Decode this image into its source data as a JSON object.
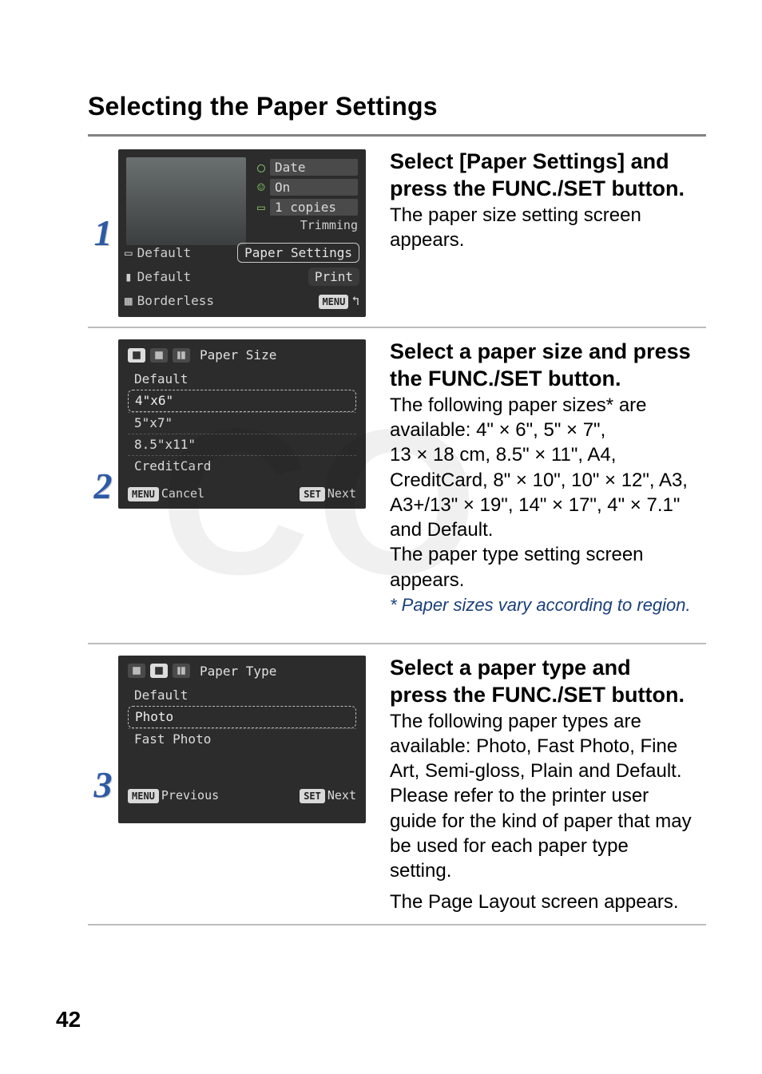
{
  "title": "Selecting the Paper Settings",
  "page_number": "42",
  "step1": {
    "number": "1",
    "heading_a": "Select [Paper Settings] and",
    "heading_b": "press the FUNC./SET button.",
    "body_a": "The paper size setting screen",
    "body_b": "appears.",
    "preview": {
      "date_label": "Date",
      "on_label": "On",
      "copies_label": "1 copies",
      "trimming_label": "Trimming",
      "row1_left": "Default",
      "row1_right": "Paper Settings",
      "row2_left": "Default",
      "row2_right": "Print",
      "row3_left": "Borderless",
      "menu_label": "MENU"
    }
  },
  "step2": {
    "number": "2",
    "heading_a": "Select a paper size and press",
    "heading_b": "the FUNC./SET button.",
    "body_a": "The following paper sizes* are",
    "body_b": "available: 4\" × 6\", 5\" × 7\",",
    "body_c": "13 × 18 cm, 8.5\" × 11\", A4,",
    "body_d": "CreditCard, 8\" × 10\", 10\" × 12\", A3,",
    "body_e": "A3+/13\" × 19\", 14\" × 17\", 4\" × 7.1\"",
    "body_f": "and Default.",
    "body_g": "The paper type setting screen",
    "body_h": "appears.",
    "footnote": "* Paper sizes vary according to region.",
    "dialog": {
      "tab_title": "Paper Size",
      "options": [
        "Default",
        "4\"x6\"",
        "5\"x7\"",
        "8.5\"x11\"",
        "CreditCard"
      ],
      "selected_index": 1,
      "menu_btn": "MENU",
      "menu_label": "Cancel",
      "set_btn": "SET",
      "set_label": "Next"
    }
  },
  "step3": {
    "number": "3",
    "heading_a": "Select a paper type and",
    "heading_b": "press the FUNC./SET button.",
    "body_a": "The following paper types are",
    "body_b": "available: Photo, Fast Photo, Fine",
    "body_c": "Art, Semi-gloss, Plain and Default.",
    "body_d": "Please refer to the printer user",
    "body_e": "guide for the kind of paper that may",
    "body_f": "be used for each paper type",
    "body_g": "setting.",
    "body_h": "The Page Layout screen appears.",
    "dialog": {
      "tab_title": "Paper Type",
      "options": [
        "Default",
        "Photo",
        "Fast Photo"
      ],
      "selected_index": 1,
      "menu_btn": "MENU",
      "menu_label": "Previous",
      "set_btn": "SET",
      "set_label": "Next"
    }
  }
}
